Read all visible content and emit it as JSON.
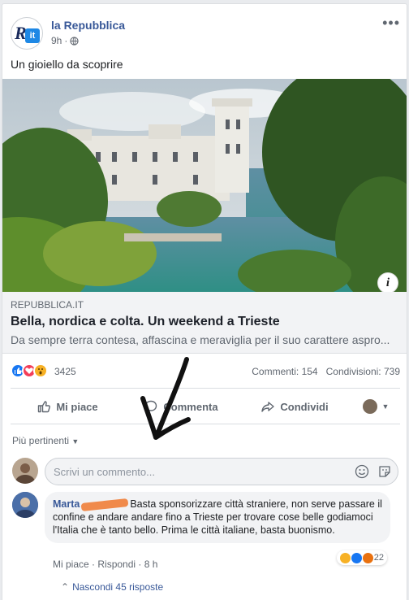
{
  "post": {
    "page_name": "la Repubblica",
    "time": "9h",
    "separator": "·",
    "text": "Un gioiello da scoprire",
    "logo_letter": "R",
    "logo_badge": "it"
  },
  "link": {
    "domain": "REPUBBLICA.IT",
    "title": "Bella, nordica e colta. Un weekend a Trieste",
    "description": "Da sempre terra contesa, affascina e meraviglia per il suo carattere aspro...",
    "info_label": "i"
  },
  "stats": {
    "reactions": "3425",
    "comments": "Commenti: 154",
    "shares": "Condivisioni: 739"
  },
  "actions": {
    "like": "Mi piace",
    "comment": "Commenta",
    "share": "Condividi"
  },
  "sort_label": "Più pertinenti",
  "composer": {
    "placeholder": "Scrivi un commento..."
  },
  "comment": {
    "author": "Marta",
    "text": "Basta sponsorizzare città straniere, non serve passare il confine e andare andare fino a Trieste per trovare cose belle godiamoci l'Italia che è tanto bello. Prima le città italiane, basta buonismo.",
    "like": "Mi piace",
    "reply": "Rispondi",
    "time": "8 h",
    "dot": "·",
    "reaction_count": "22",
    "hide_replies": "Nascondi 45 risposte"
  },
  "colors": {
    "link_blue": "#385898",
    "like_blue": "#1877f2",
    "love_red": "#f33e58",
    "wow_yellow": "#f7b125",
    "redaction": "#f08a4b"
  },
  "icons": {
    "more": "ellipsis-icon",
    "privacy": "globe-icon",
    "like": "thumbs-up-icon",
    "comment": "speech-bubble-icon",
    "share": "share-arrow-icon",
    "emoji": "emoji-icon",
    "sticker": "sticker-icon",
    "annotation": "hand-drawn-arrow"
  }
}
